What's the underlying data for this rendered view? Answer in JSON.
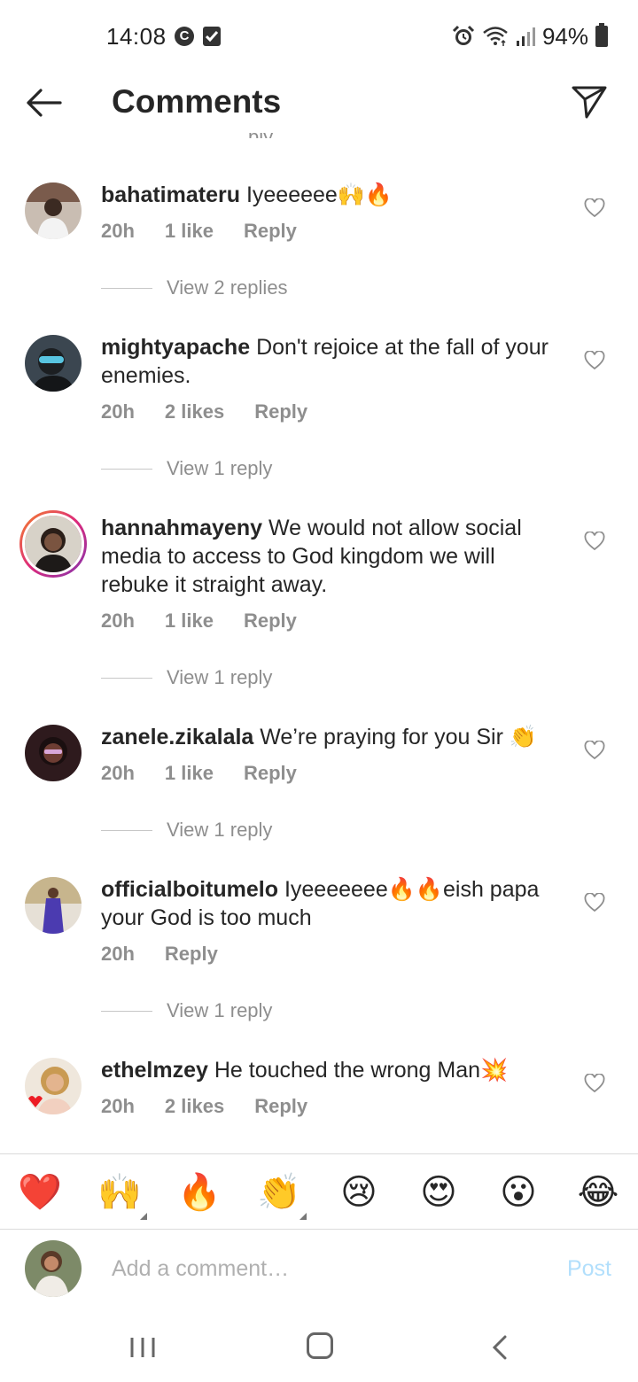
{
  "status_bar": {
    "time": "14:08",
    "battery": "94%"
  },
  "header": {
    "title": "Comments"
  },
  "colors": {
    "text": "#262626",
    "muted": "#8e8e8e",
    "post_disabled": "#b2dffc",
    "heart_red": "#ed1c24"
  },
  "comments": [
    {
      "username": "bahatimateru",
      "text": "Iyeeeeee🙌🔥",
      "time": "20h",
      "likes": "1 like",
      "reply": "Reply",
      "view_replies": "View 2 replies"
    },
    {
      "username": "mightyapache",
      "text": "Don't rejoice at the fall of your enemies.",
      "time": "20h",
      "likes": "2 likes",
      "reply": "Reply",
      "view_replies": "View 1 reply"
    },
    {
      "username": "hannahmayeny",
      "text": "We would not allow social media to access to God kingdom we will rebuke it straight away.",
      "time": "20h",
      "likes": "1 like",
      "reply": "Reply",
      "view_replies": "View 1 reply"
    },
    {
      "username": "zanele.zikalala",
      "text": "We’re praying for you Sir 👏",
      "time": "20h",
      "likes": "1 like",
      "reply": "Reply",
      "view_replies": "View 1 reply"
    },
    {
      "username": "officialboitumelo",
      "text": "Iyeeeeeee🔥🔥eish papa your God is too much",
      "time": "20h",
      "likes": "",
      "reply": "Reply",
      "view_replies": "View 1 reply"
    },
    {
      "username": "ethelmzey",
      "text": "He touched the wrong Man💥",
      "time": "20h",
      "likes": "2 likes",
      "reply": "Reply",
      "view_replies": ""
    }
  ],
  "emoji_bar": [
    "❤️",
    "🙌",
    "🔥",
    "👏",
    "😢",
    "😍",
    "😮",
    "😂"
  ],
  "input": {
    "placeholder": "Add a comment…",
    "post_label": "Post"
  },
  "icons": {
    "back": "arrow-left-icon",
    "send": "paper-plane-icon",
    "heart": "heart-outline-icon",
    "alarm": "alarm-icon",
    "wifi": "wifi-icon",
    "signal": "signal-icon",
    "battery": "battery-icon"
  }
}
